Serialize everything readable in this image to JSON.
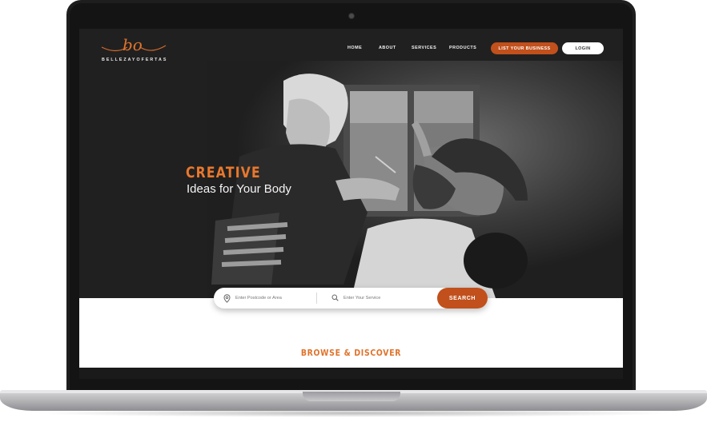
{
  "brand": {
    "logo_script": "bo",
    "logo_text": "BELLEZAYOFERTAS"
  },
  "nav": {
    "home": "HOME",
    "about": "ABOUT",
    "services": "SERVICES",
    "products": "PRODUCTS"
  },
  "actions": {
    "list_business": "LIST YOUR BUSINESS",
    "login": "LOGIN"
  },
  "hero": {
    "title": "CREATIVE",
    "subtitle": "Ideas for Your Body"
  },
  "search": {
    "location_placeholder": "Enter Postcode or Area",
    "service_placeholder": "Enter Your Service",
    "button": "SEARCH"
  },
  "section": {
    "browse_title": "BROWSE & DISCOVER"
  },
  "colors": {
    "accent": "#c1501c",
    "accent_text": "#e8782d",
    "background_dark": "#262626"
  },
  "icons": {
    "location": "location-pin-icon",
    "search": "search-icon"
  }
}
